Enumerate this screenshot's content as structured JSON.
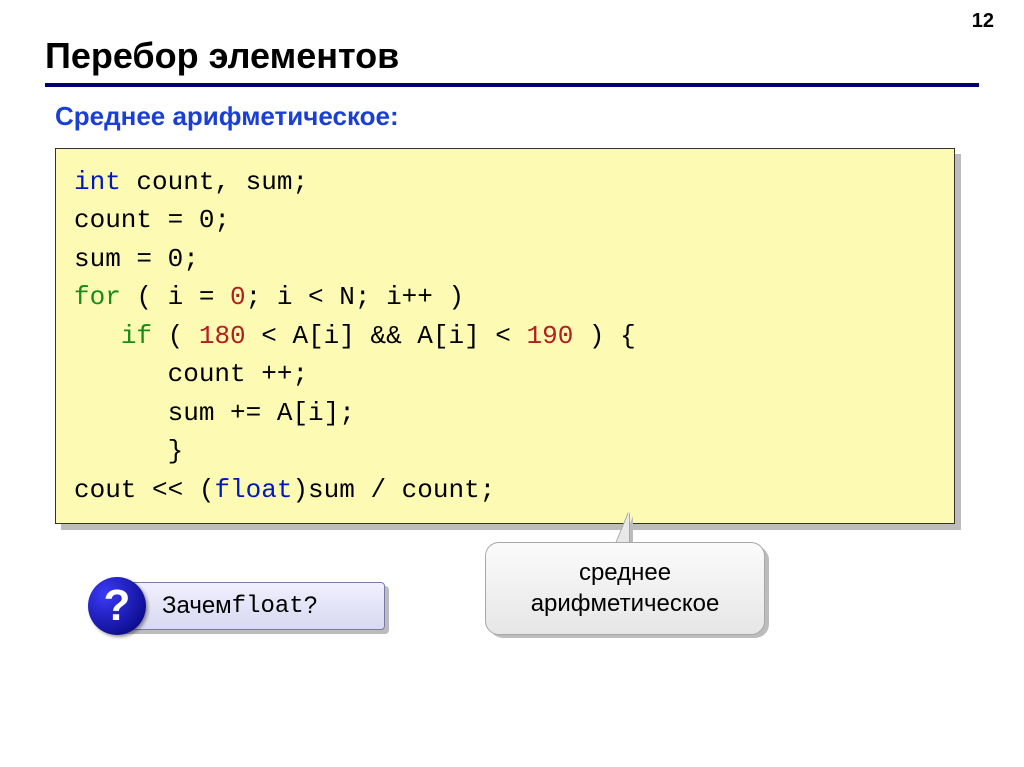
{
  "page_number": "12",
  "title": "Перебор элементов",
  "subtitle": "Среднее арифметическое:",
  "code": {
    "l1_kw": "int",
    "l1_rest": " count, sum;",
    "l2": "count = 0;",
    "l3": "sum = 0;",
    "l4_kw": "for",
    "l4_a": " ( i = ",
    "l4_n0": "0",
    "l4_b": "; i < N; i++ )",
    "l5_kw": "if",
    "l5_a": " ( ",
    "l5_n1": "180",
    "l5_b": " < A[i] && A[i] < ",
    "l5_n2": "190",
    "l5_c": " ) {",
    "l6": "count ++;",
    "l7": "sum += A[i];",
    "l8": "}",
    "l9_a": "cout << (",
    "l9_kw": "float",
    "l9_b": ")sum / count;"
  },
  "question": {
    "icon": "?",
    "prefix": "Зачем ",
    "mono": "float",
    "suffix": "?"
  },
  "callout": {
    "line1": "среднее",
    "line2": "арифметическое"
  }
}
